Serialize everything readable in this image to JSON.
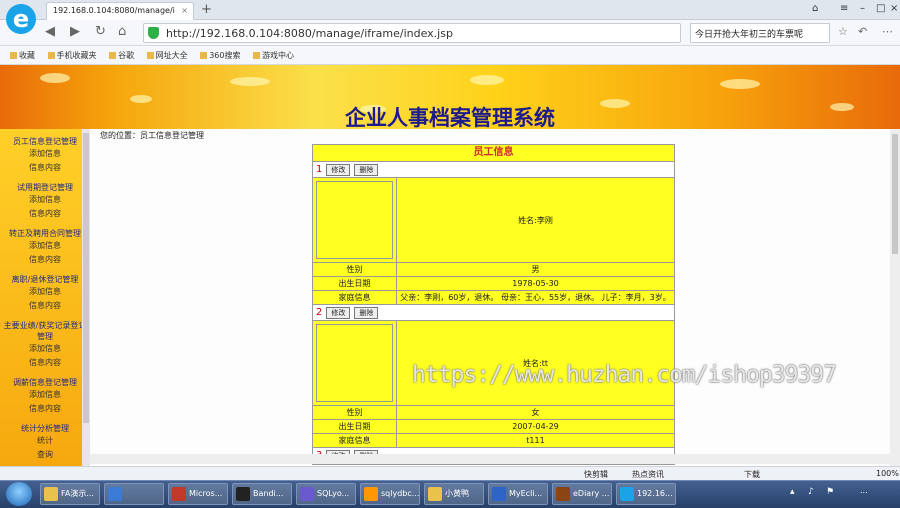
{
  "browser": {
    "tab_title": "192.168.0.104:8080/manage/i",
    "url": "http://192.168.0.104:8080/manage/iframe/index.jsp",
    "search_text": "今日开抢大年初三的车票呢",
    "bookmarks": [
      "收藏",
      "手机收藏夹",
      "谷歌",
      "网址大全",
      "360搜索",
      "游戏中心"
    ],
    "status_items": [
      "快剪辑",
      "热点资讯",
      "下载",
      "100%"
    ],
    "new_tab": "+"
  },
  "page": {
    "system_title": "企业人事档案管理系统",
    "breadcrumb": "您的位置：员工信息登记管理"
  },
  "sidebar": {
    "groups": [
      {
        "title": "员工信息登记管理",
        "items": [
          "添加信息",
          "信息内容"
        ]
      },
      {
        "title": "试用期登记管理",
        "items": [
          "添加信息",
          "信息内容"
        ]
      },
      {
        "title": "转正及聘用合同管理",
        "items": [
          "添加信息",
          "信息内容"
        ]
      },
      {
        "title": "离职/退休登记管理",
        "items": [
          "添加信息",
          "信息内容"
        ]
      },
      {
        "title": "主要业绩/获奖记录登记管理",
        "items": [
          "添加信息",
          "信息内容"
        ]
      },
      {
        "title": "调薪信息登记管理",
        "items": [
          "添加信息",
          "信息内容"
        ]
      },
      {
        "title": "统计分析管理",
        "items": [
          "统计",
          "查询"
        ]
      }
    ]
  },
  "table": {
    "header": "员工信息",
    "edit_label": "修改",
    "delete_label": "删除",
    "records": [
      {
        "index": "1",
        "name": "姓名:李刚",
        "gender_label": "性别",
        "gender": "男",
        "birth_label": "出生日期",
        "birth": "1978-05-30",
        "family_label": "家庭信息",
        "family": "父亲：李刚，60岁，退休。 母亲：王心，55岁，退休。 儿子：李月，3岁。"
      },
      {
        "index": "2",
        "name": "姓名:tt",
        "gender_label": "性别",
        "gender": "女",
        "birth_label": "出生日期",
        "birth": "2007-04-29",
        "family_label": "家庭信息",
        "family": "t111"
      },
      {
        "index": "3"
      }
    ]
  },
  "watermark": "https://www.huzhan.com/ishop39397",
  "taskbar": {
    "items": [
      "FA演示...",
      "",
      "Micros...",
      "Bandi...",
      "SQLyo...",
      "sqlydbc...",
      "小黄鸭",
      "MyEcli...",
      "eDiary ...",
      "192.16..."
    ],
    "time": "..."
  }
}
